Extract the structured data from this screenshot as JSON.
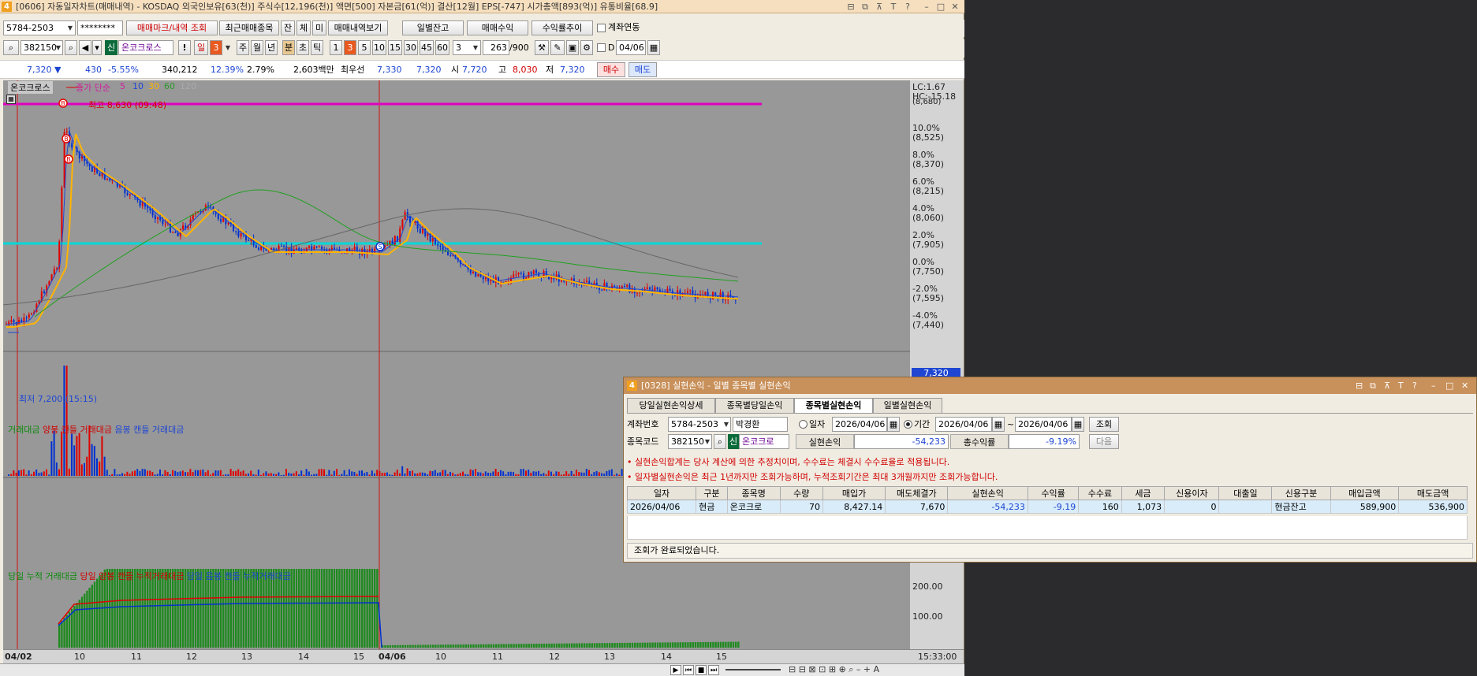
{
  "main": {
    "title": "[0606] 자동일자차트(매매내역) - KOSDAQ 외국인보유[63(천)] 주식수[12,196(천)] 액면[500] 자본금[61(억)] 결산[12월] EPS[-747] 시가총액[893(억)] 유통비율[68.9]",
    "icon": "4",
    "toolbar1": {
      "account": "5784-2503",
      "password": "********",
      "btn_markview": "매매마크/내역 조회",
      "btn_recent": "최근매매종목",
      "btn_jan": "잔",
      "btn_che": "체",
      "btn_mi": "미",
      "btn_history": "매매내역보기",
      "btn_daily_balance": "일별잔고",
      "btn_profit": "매매수익",
      "btn_yield": "수익률추이",
      "chk_link": "계좌연동"
    },
    "toolbar2": {
      "code": "382150",
      "sin": "신",
      "name": "온코크로스",
      "bang": "!",
      "period_day": "일",
      "period_val": "3",
      "btn_week": "주",
      "btn_month": "월",
      "btn_year": "년",
      "btn_min": "분",
      "btn_sec": "초",
      "btn_tick": "틱",
      "nums": [
        "1",
        "3",
        "5",
        "10",
        "15",
        "30",
        "45",
        "60"
      ],
      "count_sel": "3",
      "bars": "263",
      "bars_total": "/900",
      "chk_d": "D",
      "date": "04/06"
    },
    "quote": {
      "price": "7,320 ▼",
      "change": "430",
      "change_pct": "-5.55%",
      "volume": "340,212",
      "turnover_pct": "12.39%",
      "pct2": "2.79%",
      "amount": "2,603백만",
      "best_label": "최우선",
      "best_ask": "7,330",
      "best_bid": "7,320",
      "open_label": "시",
      "open": "7,720",
      "high_label": "고",
      "high": "8,030",
      "low_label": "저",
      "low": "7,320",
      "buy": "매수",
      "sell": "매도"
    },
    "chart": {
      "legend_name": "온코크로스",
      "legend_ma_label": "종가 단순",
      "ma_periods": [
        "5",
        "10",
        "30",
        "60",
        "120"
      ],
      "ma_colors": [
        "#1e46d2",
        "#ffb400",
        "#2a9a2a",
        "#7a7a7a",
        "#777777"
      ],
      "high_annotation": "최고 8,630 (09:48)",
      "low_annotation": "최저 7,200 (15:15)",
      "lc": "LC:1.67",
      "hc": "HC:-15.18",
      "price_axis": [
        {
          "pct": "10.0%",
          "price": "(8,525)"
        },
        {
          "pct": "8.0%",
          "price": "(8,370)"
        },
        {
          "pct": "6.0%",
          "price": "(8,215)"
        },
        {
          "pct": "4.0%",
          "price": "(8,060)"
        },
        {
          "pct": "2.0%",
          "price": "(7,905)"
        },
        {
          "pct": "0.0%",
          "price": "(7,750)"
        },
        {
          "pct": "-2.0%",
          "price": "(7,595)"
        },
        {
          "pct": "-4.0%",
          "price": "(7,440)"
        }
      ],
      "price_axis_top": "(8,680)",
      "current_price_tag": "7,320",
      "vol_legend": [
        "거래대금",
        "양봉 캔들 거래대금",
        "음봉 캔들 거래대금"
      ],
      "cum_legend": [
        "당일 누적 거래대금",
        "당일 양봉 캔들 누적거래대금",
        "당일 음봉 캔들 누적거래대금"
      ],
      "cum_axis": [
        "200.00",
        "100.00"
      ],
      "x_labels": [
        "04/02",
        "10",
        "11",
        "12",
        "13",
        "14",
        "15",
        "04/06",
        "10",
        "11",
        "12",
        "13",
        "14",
        "15"
      ],
      "x_time": "15:33:00",
      "buy_mark": "B",
      "sell_mark": "S"
    }
  },
  "popup": {
    "icon": "4",
    "title": "[0328] 실현손익 - 일별 종목별 실현손익",
    "tabs": [
      "당일실현손익상세",
      "종목별당일손익",
      "종목별실현손익",
      "일별실현손익"
    ],
    "account_label": "계좌번호",
    "account": "5784-2503",
    "owner": "박경환",
    "radio_date": "일자",
    "date_single": "2026/04/06",
    "radio_period": "기간",
    "date_from": "2026/04/06",
    "tilde": "~",
    "date_to": "2026/04/06",
    "btn_query": "조회",
    "code_label": "종목코드",
    "code": "382150",
    "sin": "신",
    "name": "온코크로",
    "realized_label": "실현손익",
    "realized": "-54,233",
    "total_yield_label": "총수익률",
    "total_yield": "-9.19%",
    "btn_next": "다음",
    "note1": "• 실현손익합계는 당사 계산에 의한 추정치이며, 수수료는 체결시 수수료율로 적용됩니다.",
    "note2": "• 일자별실현손익은 최근 1년까지만 조회가능하며, 누적조회기간은 최대 3개월까지만 조회가능합니다.",
    "columns": [
      "일자",
      "구분",
      "종목명",
      "수량",
      "매입가",
      "매도체결가",
      "실현손익",
      "수익률",
      "수수료",
      "세금",
      "신용이자",
      "대출일",
      "신용구분",
      "매입금액",
      "매도금액"
    ],
    "rows": [
      [
        "2026/04/06",
        "현금",
        "온코크로",
        "70",
        "8,427.14",
        "7,670",
        "-54,233",
        "-9.19",
        "160",
        "1,073",
        "0",
        "",
        "현금잔고",
        "589,900",
        "536,900"
      ]
    ],
    "status": "조회가 완료되었습니다."
  }
}
